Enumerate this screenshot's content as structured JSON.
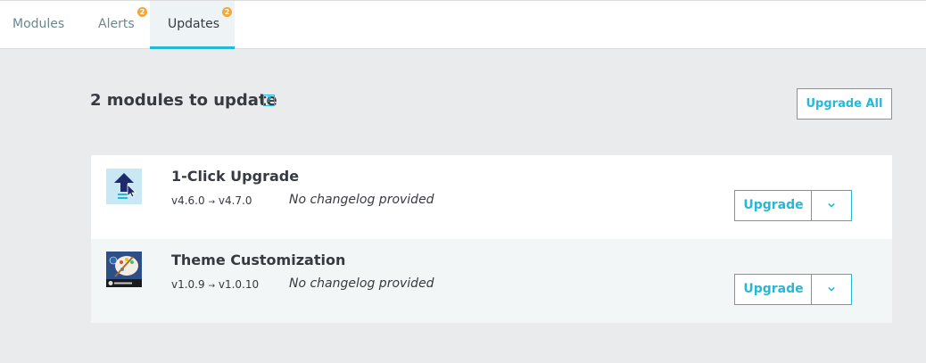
{
  "tabs": [
    {
      "label": "Modules",
      "badge": null,
      "active": false
    },
    {
      "label": "Alerts",
      "badge": "2",
      "active": false
    },
    {
      "label": "Updates",
      "badge": "2",
      "active": true
    }
  ],
  "header": {
    "title": "2 modules to update",
    "help_icon": "?",
    "upgrade_all_label": "Upgrade All"
  },
  "modules": [
    {
      "name": "1-Click Upgrade",
      "from": "v4.6.0",
      "arrow": "→",
      "to": "v4.7.0",
      "changelog": "No changelog provided",
      "upgrade_label": "Upgrade",
      "icon": "upload-arrow-icon"
    },
    {
      "name": "Theme Customization",
      "from": "v1.0.9",
      "arrow": "→",
      "to": "v1.0.10",
      "changelog": "No changelog provided",
      "upgrade_label": "Upgrade",
      "icon": "palette-icon"
    }
  ],
  "colors": {
    "accent": "#25b9d7",
    "badge": "#f0a73b",
    "text": "#363a41",
    "muted": "#6c868e",
    "background": "#eaebec"
  }
}
